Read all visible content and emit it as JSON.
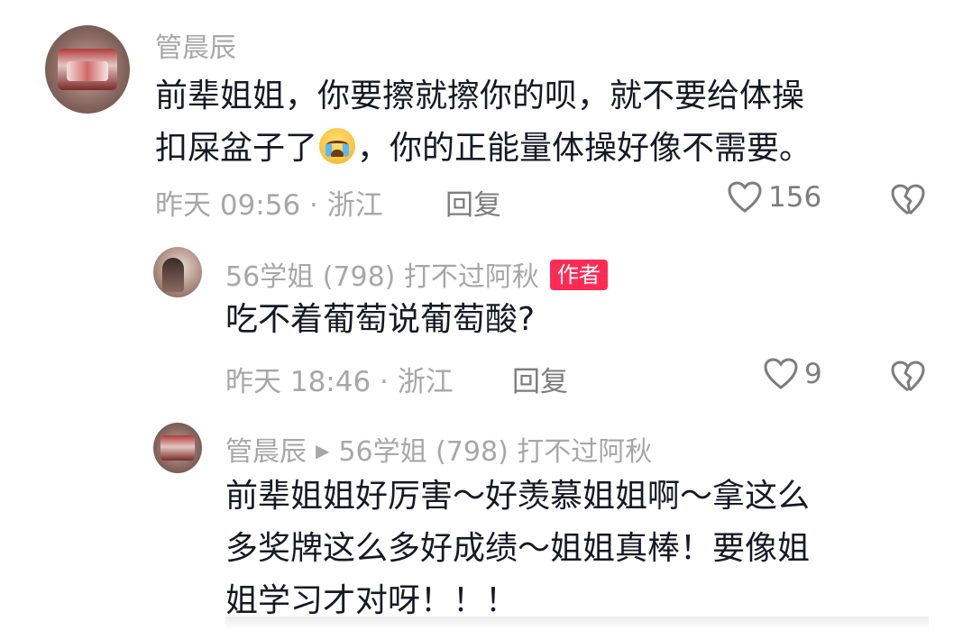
{
  "comments": [
    {
      "username": "管晨辰",
      "content_line1": "前辈姐姐，你要擦就擦你的呗，就不要给体操",
      "content_line2_a": "扣屎盆子了",
      "content_line2_b": "，你的正能量体操好像不需要。",
      "emoji": "crying-face",
      "time_location": "昨天 09:56 · 浙江",
      "reply_label": "回复",
      "likes": "156"
    },
    {
      "username": "56学姐 (798) 打不过阿秋",
      "badge": "作者",
      "content": "吃不着葡萄说葡萄酸?",
      "time_location": "昨天 18:46 · 浙江",
      "reply_label": "回复",
      "likes": "9"
    },
    {
      "username": "管晨辰",
      "reply_to": "56学姐 (798) 打不过阿秋",
      "content_line1": "前辈姐姐好厉害～好羡慕姐姐啊～拿这么",
      "content_line2": "多奖牌这么多好成绩～姐姐真棒！要像姐",
      "content_line3": "姐学习才对呀！！！"
    }
  ],
  "colors": {
    "username": "#a7a7a7",
    "content": "#161823",
    "badge": "#fe2c55",
    "icon": "#7d7d7d"
  }
}
